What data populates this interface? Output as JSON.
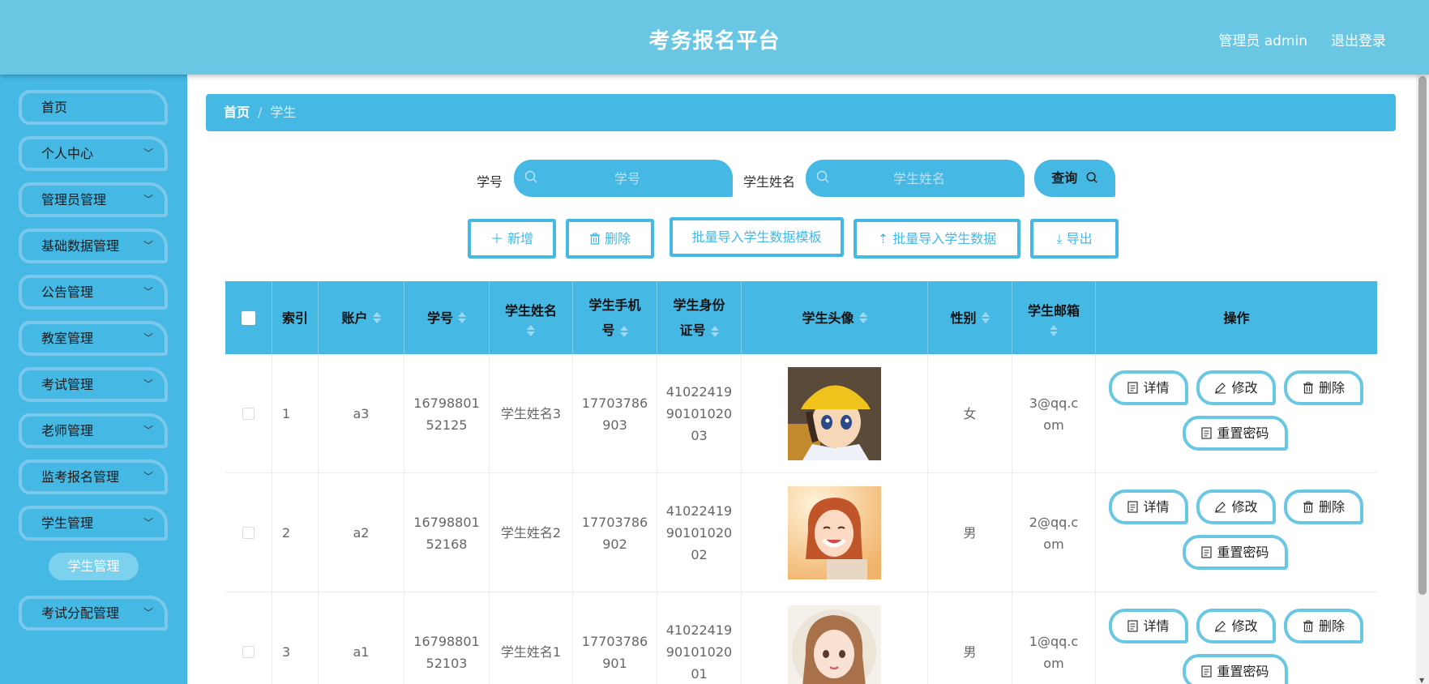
{
  "header": {
    "title": "考务报名平台",
    "user": "管理员 admin",
    "logout": "退出登录"
  },
  "sidebar": {
    "items": [
      {
        "label": "首页",
        "has_children": false
      },
      {
        "label": "个人中心",
        "has_children": true
      },
      {
        "label": "管理员管理",
        "has_children": true
      },
      {
        "label": "基础数据管理",
        "has_children": true
      },
      {
        "label": "公告管理",
        "has_children": true
      },
      {
        "label": "教室管理",
        "has_children": true
      },
      {
        "label": "考试管理",
        "has_children": true
      },
      {
        "label": "老师管理",
        "has_children": true
      },
      {
        "label": "监考报名管理",
        "has_children": true
      },
      {
        "label": "学生管理",
        "has_children": true
      },
      {
        "label": "考试分配管理",
        "has_children": true
      }
    ],
    "active_sub": "学生管理"
  },
  "breadcrumb": {
    "home": "首页",
    "separator": "/",
    "current": "学生"
  },
  "search": {
    "student_no_label": "学号",
    "student_no_placeholder": "学号",
    "student_name_label": "学生姓名",
    "student_name_placeholder": "学生姓名",
    "query_button": "查询"
  },
  "actions": {
    "add": "新增",
    "delete": "删除",
    "import_template": "批量导入学生数据模板",
    "import_data": "批量导入学生数据",
    "export": "导出"
  },
  "table": {
    "headers": {
      "index": "索引",
      "account": "账户",
      "student_no": "学号",
      "name": "学生姓名",
      "phone": "学生手机号",
      "id_card": "学生身份证号",
      "avatar": "学生头像",
      "gender": "性别",
      "email": "学生邮箱",
      "ops": "操作"
    },
    "row_buttons": {
      "detail": "详情",
      "edit": "修改",
      "delete": "删除",
      "reset": "重置密码"
    },
    "rows": [
      {
        "index": "1",
        "account": "a3",
        "student_no": "1679880152125",
        "name": "学生姓名3",
        "phone": "17703786903",
        "id_card": "410224199010102003",
        "gender": "女",
        "email": "3@qq.com",
        "avatar": "cartoon-girl-yellow-hat"
      },
      {
        "index": "2",
        "account": "a2",
        "student_no": "1679880152168",
        "name": "学生姓名2",
        "phone": "17703786902",
        "id_card": "410224199010102002",
        "gender": "男",
        "email": "2@qq.com",
        "avatar": "smiling-girl-photo"
      },
      {
        "index": "3",
        "account": "a1",
        "student_no": "1679880152103",
        "name": "学生姓名1",
        "phone": "17703786901",
        "id_card": "410224199010102001",
        "gender": "男",
        "email": "1@qq.com",
        "avatar": "illustrated-girl-portrait"
      }
    ]
  },
  "colors": {
    "header": "#6ac7e3",
    "accent": "#45b8e4",
    "button_border": "#7cc8ec"
  }
}
